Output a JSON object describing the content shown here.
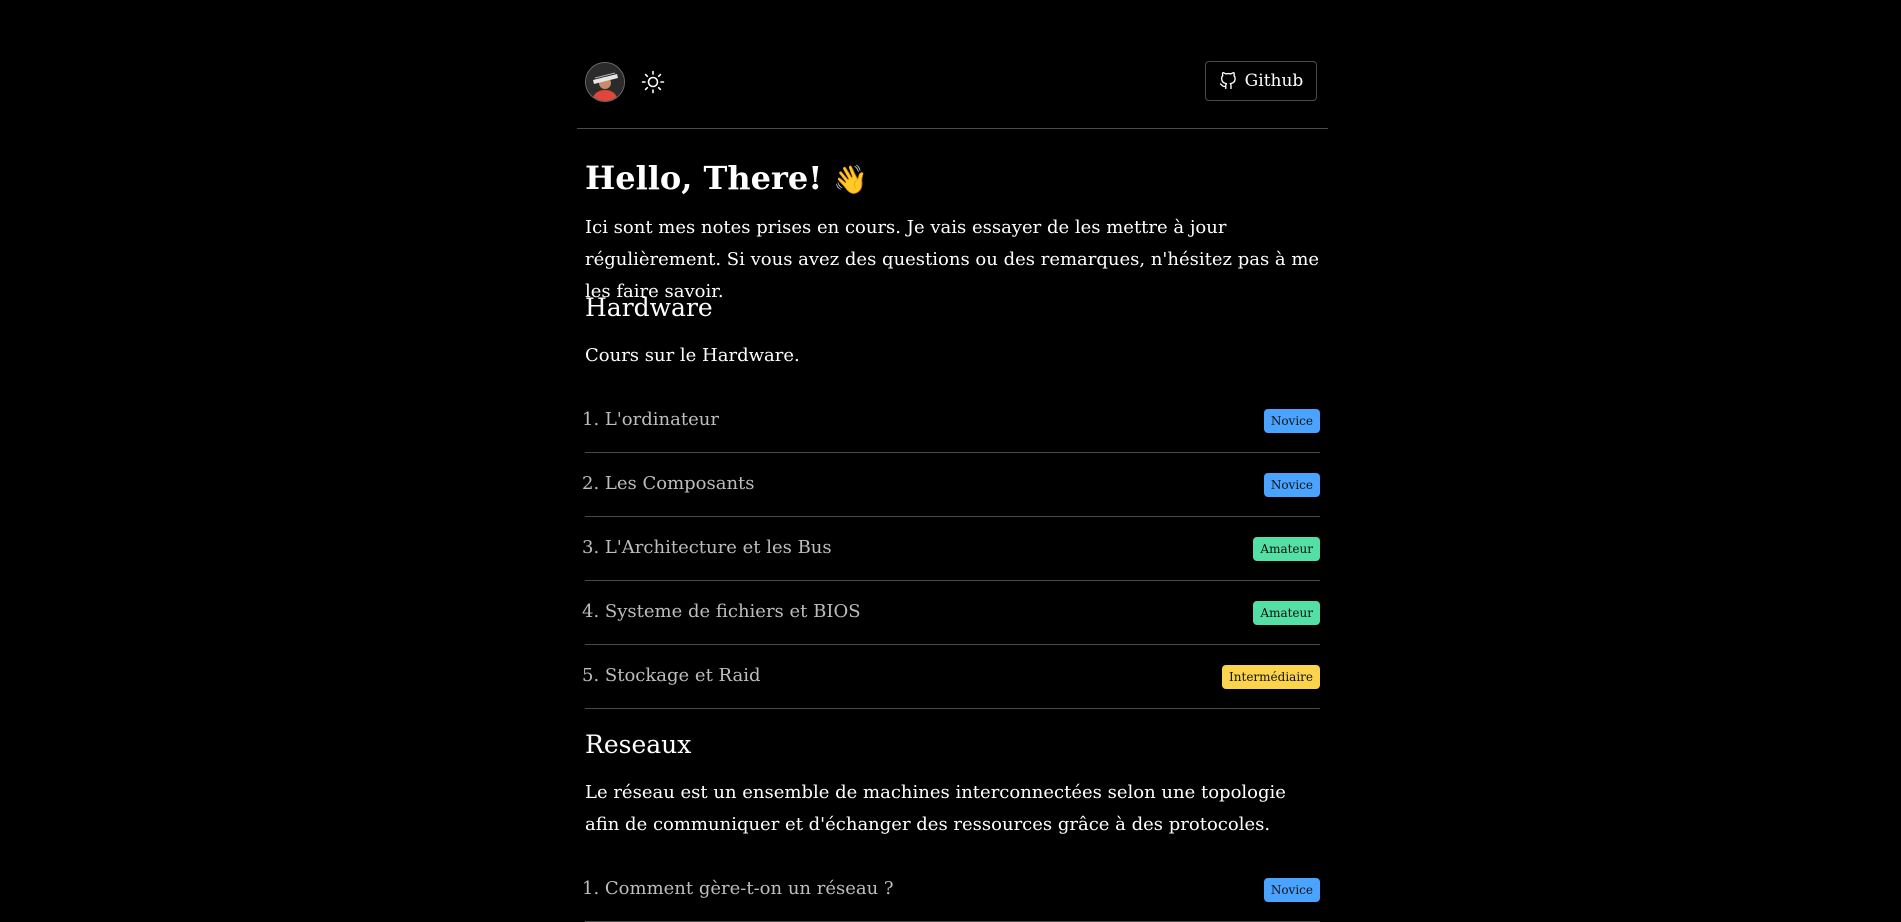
{
  "header": {
    "avatar_alt": "avatar",
    "theme_icon": "sun-icon",
    "github_icon": "github-icon",
    "github_label": "Github"
  },
  "intro": {
    "title": "Hello, There!",
    "emoji": "👋",
    "text": "Ici sont mes notes prises en cours. Je vais essayer de les mettre à jour régulièrement. Si vous avez des questions ou des remarques, n'hésitez pas à me les faire savoir."
  },
  "sections": [
    {
      "title": "Hardware",
      "description": "Cours sur le Hardware.",
      "items": [
        {
          "label": "1. L'ordinateur",
          "level": "Novice",
          "color": "#4aa3ff"
        },
        {
          "label": "2. Les Composants",
          "level": "Novice",
          "color": "#4aa3ff"
        },
        {
          "label": "3. L'Architecture et les Bus",
          "level": "Amateur",
          "color": "#54e0a4"
        },
        {
          "label": "4. Systeme de fichiers et BIOS",
          "level": "Amateur",
          "color": "#54e0a4"
        },
        {
          "label": "5. Stockage et Raid",
          "level": "Intermédiaire",
          "color": "#fcd34d"
        }
      ]
    },
    {
      "title": "Reseaux",
      "description": "Le réseau est un ensemble de machines interconnectées selon une topologie afin de communiquer et d'échanger des ressources grâce à des protocoles.",
      "items": [
        {
          "label": "1. Comment gère-t-on un réseau ?",
          "level": "Novice",
          "color": "#4aa3ff"
        }
      ]
    }
  ]
}
